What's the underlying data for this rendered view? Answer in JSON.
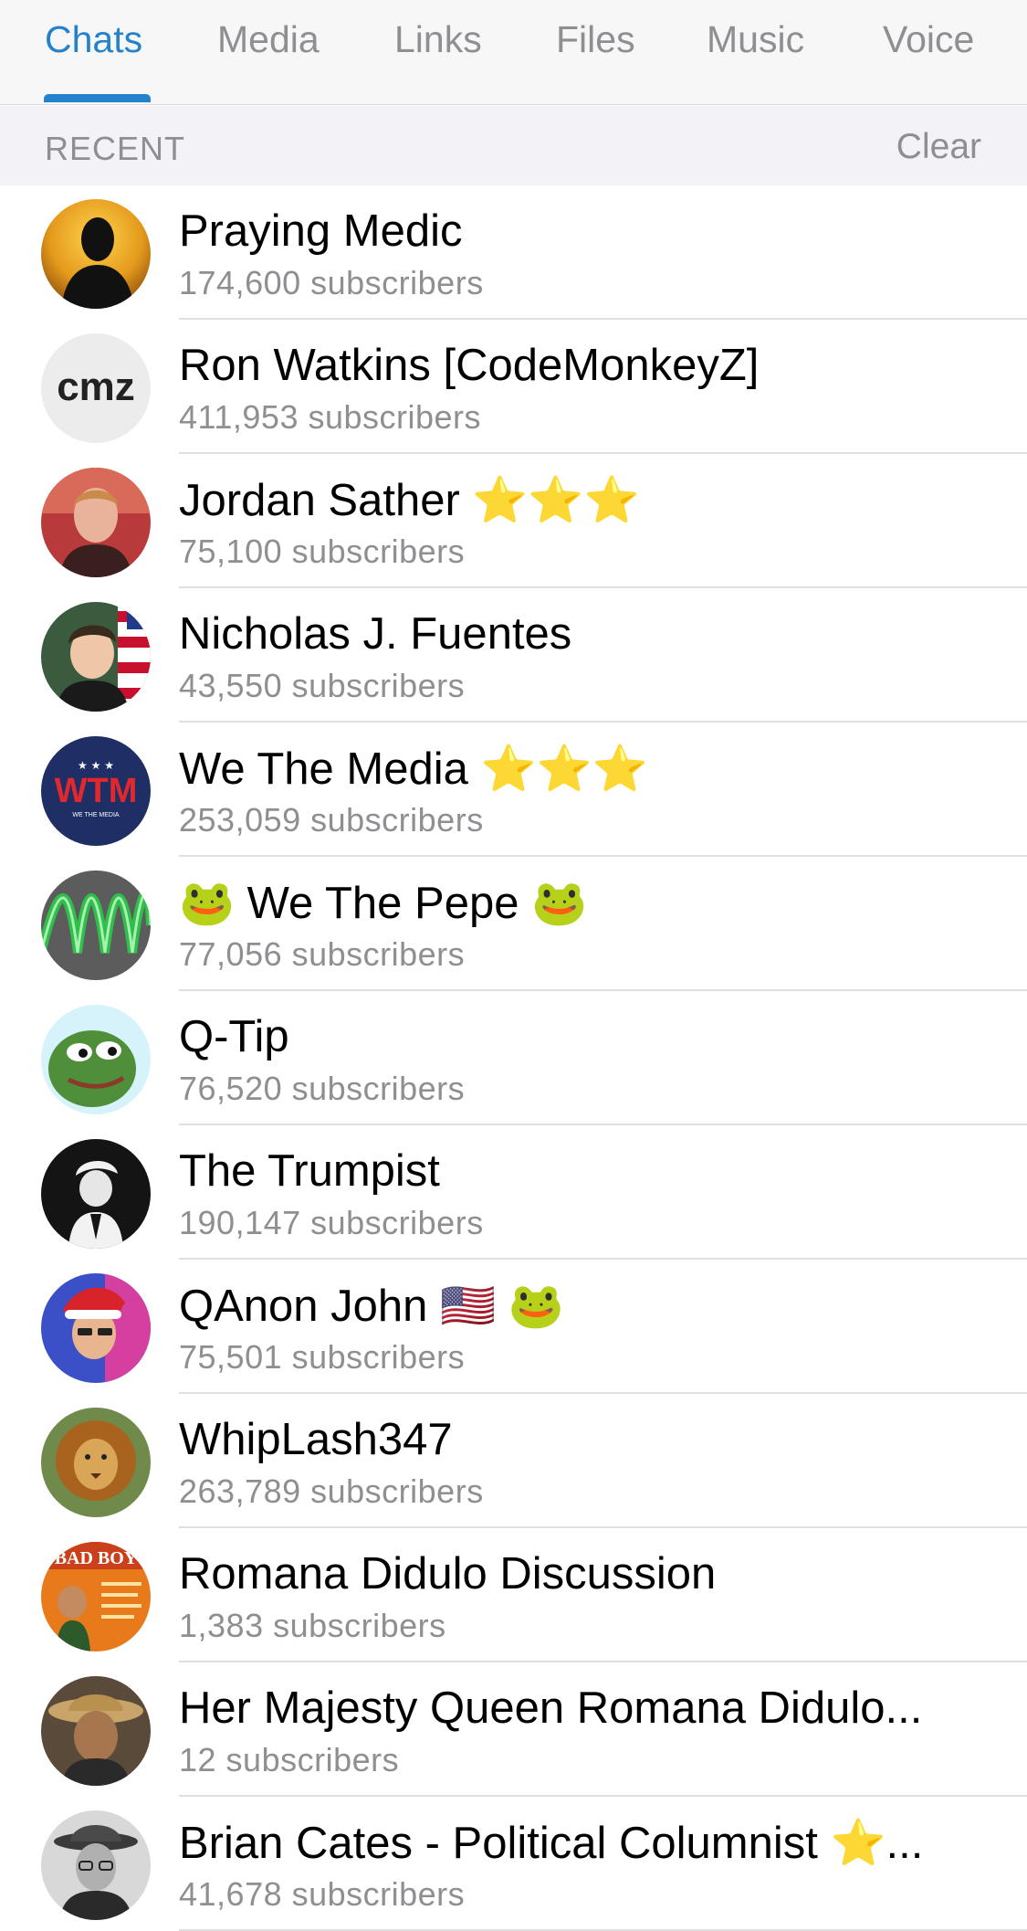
{
  "tabs": [
    {
      "label": "Chats",
      "active": true
    },
    {
      "label": "Media",
      "active": false
    },
    {
      "label": "Links",
      "active": false
    },
    {
      "label": "Files",
      "active": false
    },
    {
      "label": "Music",
      "active": false
    },
    {
      "label": "Voice",
      "active": false
    }
  ],
  "section": {
    "title": "RECENT",
    "clear_label": "Clear"
  },
  "chats": [
    {
      "name": "Praying Medic",
      "subscribers": "174,600 subscribers",
      "avatar_icon": "silhouette-sunset-avatar"
    },
    {
      "name": "Ron Watkins [CodeMonkeyZ]",
      "subscribers": "411,953 subscribers",
      "avatar_icon": "cmz-logo-avatar",
      "avatar_text": "cmz"
    },
    {
      "name": "Jordan Sather ⭐⭐⭐",
      "subscribers": "75,100 subscribers",
      "avatar_icon": "portrait-avatar"
    },
    {
      "name": "Nicholas J. Fuentes",
      "subscribers": "43,550 subscribers",
      "avatar_icon": "portrait-flag-avatar"
    },
    {
      "name": "We The Media ⭐⭐⭐",
      "subscribers": "253,059 subscribers",
      "avatar_icon": "wtm-logo-avatar",
      "avatar_text": "WTM",
      "avatar_subtext": "WE THE MEDIA"
    },
    {
      "name": "🐸 We The Pepe 🐸",
      "subscribers": "77,056 subscribers",
      "avatar_icon": "green-waves-avatar"
    },
    {
      "name": "Q-Tip",
      "subscribers": "76,520 subscribers",
      "avatar_icon": "pepe-frog-avatar"
    },
    {
      "name": "The Trumpist",
      "subscribers": "190,147 subscribers",
      "avatar_icon": "trump-sketch-avatar"
    },
    {
      "name": "QAnon John 🇺🇸 🐸",
      "subscribers": "75,501 subscribers",
      "avatar_icon": "santa-hat-avatar"
    },
    {
      "name": "WhipLash347",
      "subscribers": "263,789 subscribers",
      "avatar_icon": "lion-avatar"
    },
    {
      "name": "Romana Didulo Discussion",
      "subscribers": "1,383 subscribers",
      "avatar_icon": "bad-boy-poster-avatar",
      "avatar_text": "BAD BOY"
    },
    {
      "name": "Her Majesty Queen Romana Didulo...",
      "subscribers": "12 subscribers",
      "avatar_icon": "straw-hat-portrait-avatar"
    },
    {
      "name": "Brian Cates - Political Columnist ⭐...",
      "subscribers": "41,678 subscribers",
      "avatar_icon": "fedora-portrait-avatar"
    }
  ],
  "colors": {
    "accent": "#2481cc",
    "secondary_text": "#8e8e93",
    "divider": "#e0e0e0"
  }
}
